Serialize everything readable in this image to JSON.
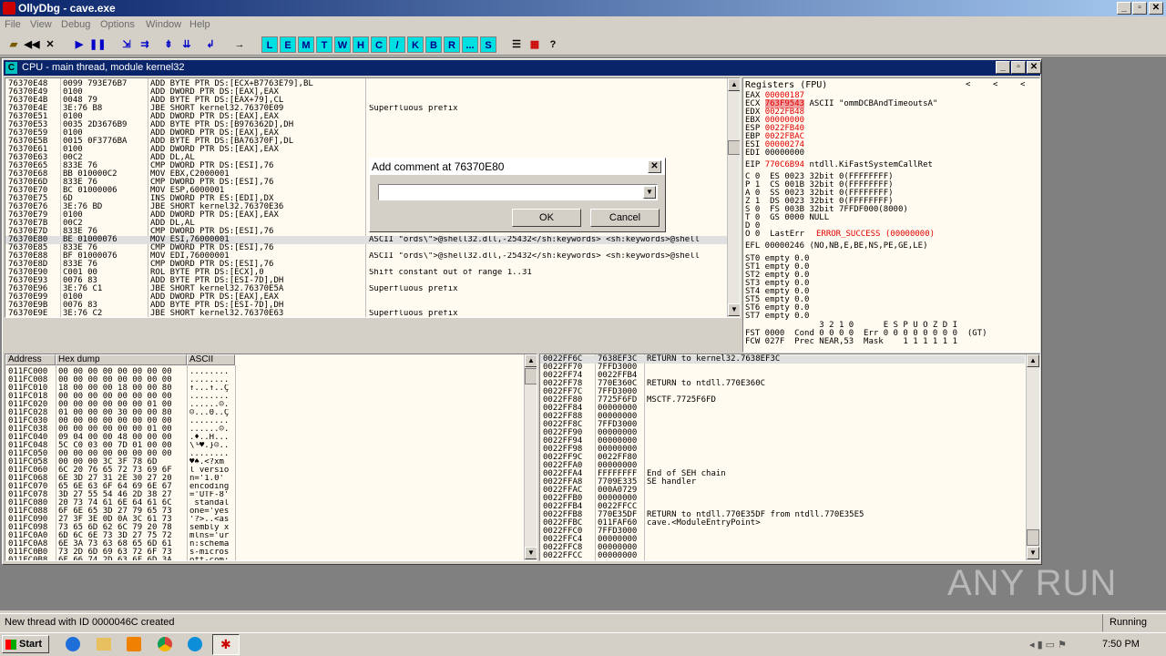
{
  "app": {
    "title": "OllyDbg - cave.exe"
  },
  "menu": [
    "File",
    "View",
    "Debug",
    "Options",
    "Window",
    "Help"
  ],
  "toolbar": {
    "letters": [
      "L",
      "E",
      "M",
      "T",
      "W",
      "H",
      "C",
      "/",
      "K",
      "B",
      "R",
      "...",
      "S"
    ]
  },
  "cpu_window": {
    "title": "CPU - main thread, module kernel32"
  },
  "disasm": {
    "rows": [
      {
        "addr": "76370E48",
        "hex": "0099 793E76B7",
        "cmd": "ADD BYTE PTR DS:[ECX+B7763E79],BL",
        "comment": ""
      },
      {
        "addr": "76370E49",
        "hex": "0100",
        "cmd": "ADD DWORD PTR DS:[EAX],EAX",
        "comment": ""
      },
      {
        "addr": "76370E4B",
        "hex": "0048 79",
        "cmd": "ADD BYTE PTR DS:[EAX+79],CL",
        "comment": ""
      },
      {
        "addr": "76370E4E",
        "hex": "3E:76 B8",
        "cmd": "JBE SHORT kernel32.76370E09",
        "comment": "Superfluous prefix"
      },
      {
        "addr": "76370E51",
        "hex": "0100",
        "cmd": "ADD DWORD PTR DS:[EAX],EAX",
        "comment": ""
      },
      {
        "addr": "76370E53",
        "hex": "0035 2D3676B9",
        "cmd": "ADD BYTE PTR DS:[B976362D],DH",
        "comment": ""
      },
      {
        "addr": "76370E59",
        "hex": "0100",
        "cmd": "ADD DWORD PTR DS:[EAX],EAX",
        "comment": ""
      },
      {
        "addr": "76370E5B",
        "hex": "0015 0F3776BA",
        "cmd": "ADD BYTE PTR DS:[BA76370F],DL",
        "comment": ""
      },
      {
        "addr": "76370E61",
        "hex": "0100",
        "cmd": "ADD DWORD PTR DS:[EAX],EAX",
        "comment": ""
      },
      {
        "addr": "76370E63",
        "hex": "00C2",
        "cmd": "ADD DL,AL",
        "comment": ""
      },
      {
        "addr": "76370E65",
        "hex": "833E 76",
        "cmd": "CMP DWORD PTR DS:[ESI],76",
        "comment": ""
      },
      {
        "addr": "76370E68",
        "hex": "BB 010000C2",
        "cmd": "MOV EBX,C2000001",
        "comment": ""
      },
      {
        "addr": "76370E6D",
        "hex": "833E 76",
        "cmd": "CMP DWORD PTR DS:[ESI],76",
        "comment": ""
      },
      {
        "addr": "76370E70",
        "hex": "BC 01000006",
        "cmd": "MOV ESP,6000001",
        "comment": ""
      },
      {
        "addr": "76370E75",
        "hex": "6D",
        "cmd": "INS DWORD PTR ES:[EDI],DX",
        "comment": ""
      },
      {
        "addr": "76370E76",
        "hex": "3E:76 BD",
        "cmd": "JBE SHORT kernel32.76370E36",
        "comment": ""
      },
      {
        "addr": "76370E79",
        "hex": "0100",
        "cmd": "ADD DWORD PTR DS:[EAX],EAX",
        "comment": ""
      },
      {
        "addr": "76370E7B",
        "hex": "00C2",
        "cmd": "ADD DL,AL",
        "comment": ""
      },
      {
        "addr": "76370E7D",
        "hex": "833E 76",
        "cmd": "CMP DWORD PTR DS:[ESI],76",
        "comment": ""
      },
      {
        "addr": "76370E80",
        "hex": "BE 01000076",
        "cmd": "MOV ESI,76000001",
        "comment": "ASCII \"ords\\\">@shell32.dll,-25432</sh:keywords> <sh:keywords>@shell"
      },
      {
        "addr": "76370E85",
        "hex": "833E 76",
        "cmd": "CMP DWORD PTR DS:[ESI],76",
        "comment": ""
      },
      {
        "addr": "76370E88",
        "hex": "BF 01000076",
        "cmd": "MOV EDI,76000001",
        "comment": "ASCII \"ords\\\">@shell32.dll,-25432</sh:keywords> <sh:keywords>@shell"
      },
      {
        "addr": "76370E8D",
        "hex": "833E 76",
        "cmd": "CMP DWORD PTR DS:[ESI],76",
        "comment": ""
      },
      {
        "addr": "76370E90",
        "hex": "C001 00",
        "cmd": "ROL BYTE PTR DS:[ECX],0",
        "comment": "Shift constant out of range 1..31"
      },
      {
        "addr": "76370E93",
        "hex": "0076 83",
        "cmd": "ADD BYTE PTR DS:[ESI-7D],DH",
        "comment": ""
      },
      {
        "addr": "76370E96",
        "hex": "3E:76 C1",
        "cmd": "JBE SHORT kernel32.76370E5A",
        "comment": "Superfluous prefix"
      },
      {
        "addr": "76370E99",
        "hex": "0100",
        "cmd": "ADD DWORD PTR DS:[EAX],EAX",
        "comment": ""
      },
      {
        "addr": "76370E9B",
        "hex": "0076 83",
        "cmd": "ADD BYTE PTR DS:[ESI-7D],DH",
        "comment": ""
      },
      {
        "addr": "76370E9E",
        "hex": "3E:76 C2",
        "cmd": "JBE SHORT kernel32.76370E63",
        "comment": "Superfluous prefix"
      }
    ],
    "selected_index": 19
  },
  "registers": {
    "title": "Registers (FPU)",
    "nav": [
      "<",
      "<",
      "<"
    ],
    "lines": [
      {
        "name": "EAX",
        "value": "00000187",
        "extra": "",
        "hl": true
      },
      {
        "name": "ECX",
        "value": "763F9543",
        "extra": "ASCII \"ommDCBAndTimeoutsA\"",
        "hl": true
      },
      {
        "name": "EDX",
        "value": "0022FB48",
        "extra": "",
        "hl": true
      },
      {
        "name": "EBX",
        "value": "00000000",
        "extra": "",
        "hl": true
      },
      {
        "name": "ESP",
        "value": "0022FB40",
        "extra": "",
        "hl": true
      },
      {
        "name": "EBP",
        "value": "0022FBAC",
        "extra": "",
        "hl": true
      },
      {
        "name": "ESI",
        "value": "00000274",
        "extra": "",
        "hl": true
      },
      {
        "name": "EDI",
        "value": "00000000",
        "extra": "",
        "hl": false
      }
    ],
    "eip": {
      "name": "EIP",
      "value": "770C6B94",
      "extra": "ntdll.KiFastSystemCallRet"
    },
    "flags": [
      "C 0  ES 0023 32bit 0(FFFFFFFF)",
      "P 1  CS 001B 32bit 0(FFFFFFFF)",
      "A 0  SS 0023 32bit 0(FFFFFFFF)",
      "Z 1  DS 0023 32bit 0(FFFFFFFF)",
      "S 0  FS 003B 32bit 7FFDF000(8000)",
      "T 0  GS 0000 NULL",
      "D 0",
      "O 0  LastErr"
    ],
    "lasterr": "ERROR_SUCCESS (00000000)",
    "efl": "EFL 00000246 (NO,NB,E,BE,NS,PE,GE,LE)",
    "st": [
      "ST0 empty 0.0",
      "ST1 empty 0.0",
      "ST2 empty 0.0",
      "ST3 empty 0.0",
      "ST4 empty 0.0",
      "ST5 empty 0.0",
      "ST6 empty 0.0",
      "ST7 empty 0.0"
    ],
    "fpu_hdr": "               3 2 1 0      E S P U O Z D I",
    "fst": "FST 0000  Cond 0 0 0 0  Err 0 0 0 0 0 0 0 0  (GT)",
    "fcw": "FCW 027F  Prec NEAR,53  Mask    1 1 1 1 1 1"
  },
  "dump": {
    "headers": [
      "Address",
      "Hex dump",
      "ASCII"
    ],
    "rows": [
      {
        "a": "011FC000",
        "h": "00 00 00 00 00 00 00 00",
        "s": "........"
      },
      {
        "a": "011FC008",
        "h": "00 00 00 00 00 00 00 00",
        "s": "........"
      },
      {
        "a": "011FC010",
        "h": "18 00 00 00 18 00 00 80",
        "s": "↑...↑..Ç"
      },
      {
        "a": "011FC018",
        "h": "00 00 00 00 00 00 00 00",
        "s": "........"
      },
      {
        "a": "011FC020",
        "h": "00 00 00 00 00 00 01 00",
        "s": "......☺."
      },
      {
        "a": "011FC028",
        "h": "01 00 00 00 30 00 00 80",
        "s": "☺...0..Ç"
      },
      {
        "a": "011FC030",
        "h": "00 00 00 00 00 00 00 00",
        "s": "........"
      },
      {
        "a": "011FC038",
        "h": "00 00 00 00 00 00 01 00",
        "s": "......☺."
      },
      {
        "a": "011FC040",
        "h": "09 04 00 00 48 00 00 00",
        "s": ".♦..H..."
      },
      {
        "a": "011FC048",
        "h": "5C C0 03 00 7D 01 00 00",
        "s": "\\└♥.}☺.."
      },
      {
        "a": "011FC050",
        "h": "00 00 00 00 00 00 00 00",
        "s": "........"
      },
      {
        "a": "011FC058",
        "h": "00 00 00 3C 3F 78 6D",
        "s": "♥♠.<?xm"
      },
      {
        "a": "011FC060",
        "h": "6C 20 76 65 72 73 69 6F",
        "s": "l versio"
      },
      {
        "a": "011FC068",
        "h": "6E 3D 27 31 2E 30 27 20",
        "s": "n='1.0' "
      },
      {
        "a": "011FC070",
        "h": "65 6E 63 6F 64 69 6E 67",
        "s": "encoding"
      },
      {
        "a": "011FC078",
        "h": "3D 27 55 54 46 2D 38 27",
        "s": "='UTF-8'"
      },
      {
        "a": "011FC080",
        "h": "20 73 74 61 6E 64 61 6C",
        "s": " standal"
      },
      {
        "a": "011FC088",
        "h": "6F 6E 65 3D 27 79 65 73",
        "s": "one='yes"
      },
      {
        "a": "011FC090",
        "h": "27 3F 3E 0D 0A 3C 61 73",
        "s": "'?>..<as"
      },
      {
        "a": "011FC098",
        "h": "73 65 6D 62 6C 79 20 78",
        "s": "sembly x"
      },
      {
        "a": "011FC0A0",
        "h": "6D 6C 6E 73 3D 27 75 72",
        "s": "mlns='ur"
      },
      {
        "a": "011FC0A8",
        "h": "6E 3A 73 63 68 65 6D 61",
        "s": "n:schema"
      },
      {
        "a": "011FC0B0",
        "h": "73 2D 6D 69 63 72 6F 73",
        "s": "s-micros"
      },
      {
        "a": "011FC0B8",
        "h": "6F 66 74 2D 63 6F 6D 3A",
        "s": "oft-com:"
      }
    ]
  },
  "stack": {
    "rows": [
      {
        "a": "0022FF6C",
        "v": "7638EF3C",
        "c": "RETURN to kernel32.7638EF3C"
      },
      {
        "a": "0022FF70",
        "v": "7FFD3000",
        "c": ""
      },
      {
        "a": "0022FF74",
        "v": "0022FFB4",
        "c": ""
      },
      {
        "a": "0022FF78",
        "v": "770E360C",
        "c": "RETURN to ntdll.770E360C"
      },
      {
        "a": "0022FF7C",
        "v": "7FFD3000",
        "c": ""
      },
      {
        "a": "0022FF80",
        "v": "7725F6FD",
        "c": "MSCTF.7725F6FD"
      },
      {
        "a": "0022FF84",
        "v": "00000000",
        "c": ""
      },
      {
        "a": "0022FF88",
        "v": "00000000",
        "c": ""
      },
      {
        "a": "0022FF8C",
        "v": "7FFD3000",
        "c": ""
      },
      {
        "a": "0022FF90",
        "v": "00000000",
        "c": ""
      },
      {
        "a": "0022FF94",
        "v": "00000000",
        "c": ""
      },
      {
        "a": "0022FF98",
        "v": "00000000",
        "c": ""
      },
      {
        "a": "0022FF9C",
        "v": "0022FF80",
        "c": ""
      },
      {
        "a": "0022FFA0",
        "v": "00000000",
        "c": ""
      },
      {
        "a": "0022FFA4",
        "v": "FFFFFFFF",
        "c": "End of SEH chain"
      },
      {
        "a": "0022FFA8",
        "v": "7709E335",
        "c": "SE handler"
      },
      {
        "a": "0022FFAC",
        "v": "000A0729",
        "c": ""
      },
      {
        "a": "0022FFB0",
        "v": "00000000",
        "c": ""
      },
      {
        "a": "0022FFB4",
        "v": "0022FFCC",
        "c": ""
      },
      {
        "a": "0022FFB8",
        "v": "770E35DF",
        "c": "RETURN to ntdll.770E35DF from ntdll.770E35E5"
      },
      {
        "a": "0022FFBC",
        "v": "011FAF60",
        "c": "cave.<ModuleEntryPoint>"
      },
      {
        "a": "0022FFC0",
        "v": "7FFD3000",
        "c": ""
      },
      {
        "a": "0022FFC4",
        "v": "00000000",
        "c": ""
      },
      {
        "a": "0022FFC8",
        "v": "00000000",
        "c": ""
      },
      {
        "a": "0022FFCC",
        "v": "00000000",
        "c": ""
      }
    ]
  },
  "dialog": {
    "title": "Add comment at 76370E80",
    "input_value": "",
    "ok": "OK",
    "cancel": "Cancel"
  },
  "statusbar": {
    "message": "New thread with ID 0000046C created",
    "state": "Running"
  },
  "taskbar": {
    "start": "Start",
    "time": "7:50 PM"
  },
  "watermark": "ANY RUN"
}
